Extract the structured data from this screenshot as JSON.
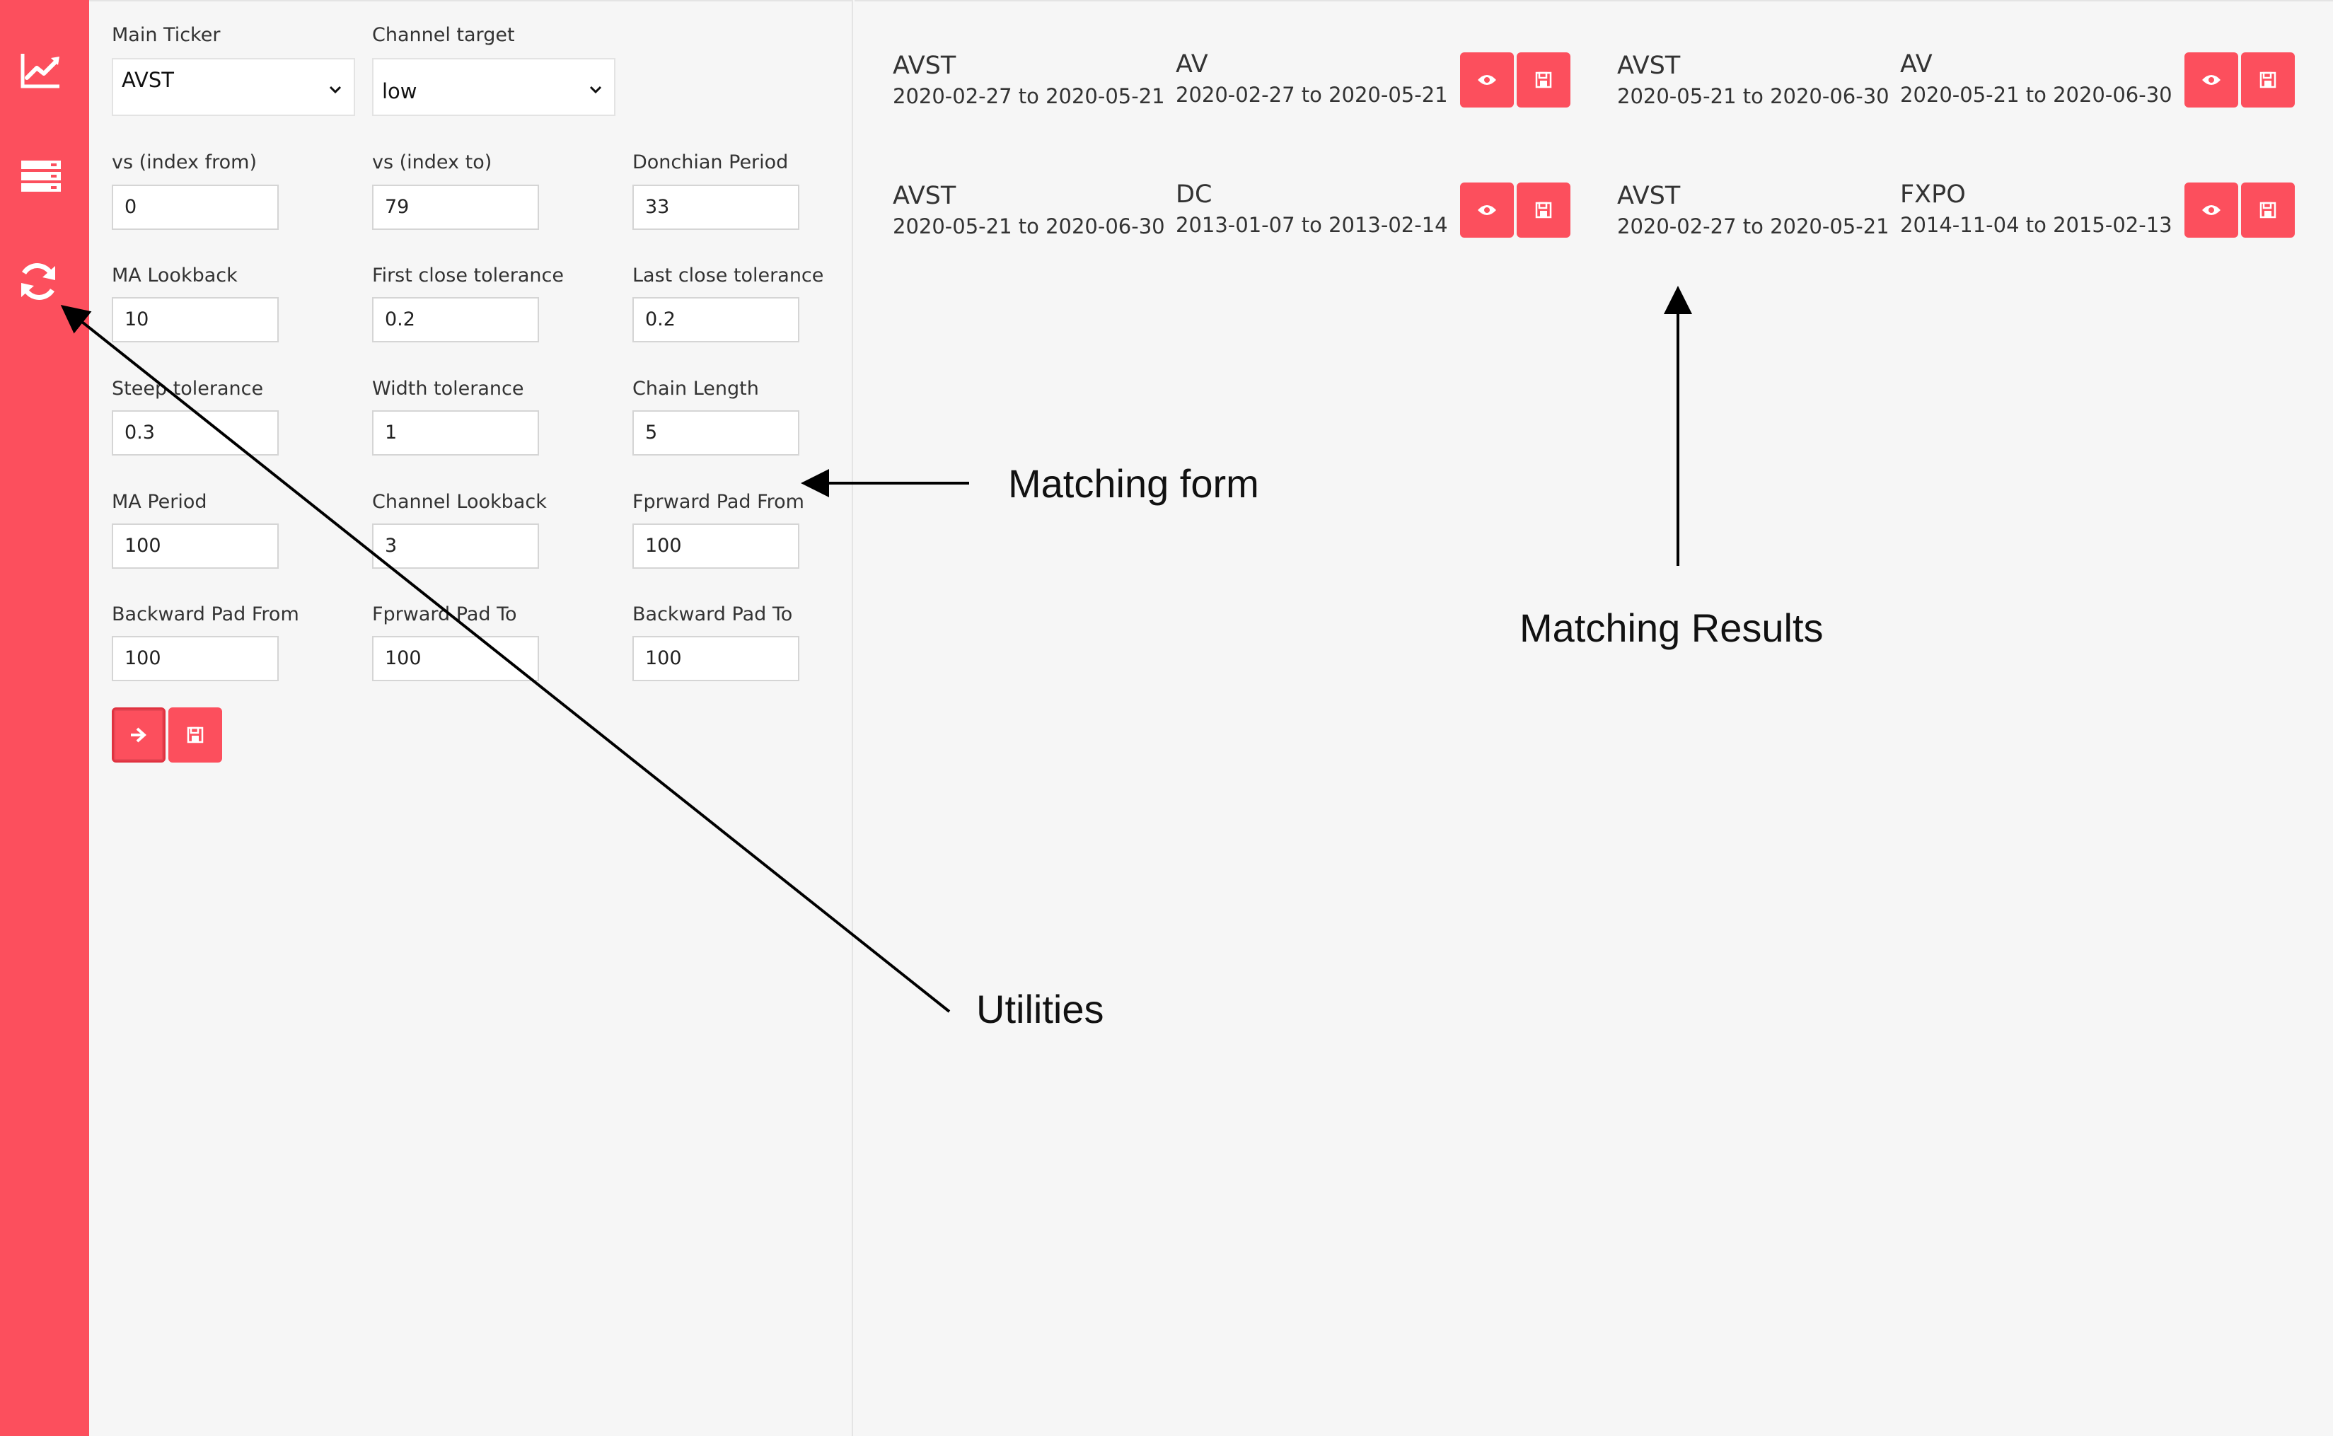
{
  "sidebar": {
    "items": [
      {
        "icon": "line-chart-icon"
      },
      {
        "icon": "server-stack-icon"
      },
      {
        "icon": "refresh-icon"
      }
    ]
  },
  "form": {
    "main_ticker": {
      "label": "Main Ticker",
      "value": "AVST"
    },
    "channel_target": {
      "label": "Channel target",
      "value": "low"
    },
    "fields": [
      {
        "label": "vs (index from)",
        "value": "0"
      },
      {
        "label": "vs (index to)",
        "value": "79"
      },
      {
        "label": "Donchian Period",
        "value": "33"
      },
      {
        "label": "MA Lookback",
        "value": "10"
      },
      {
        "label": "First close tolerance",
        "value": "0.2"
      },
      {
        "label": "Last close tolerance",
        "value": "0.2"
      },
      {
        "label": "Steep tolerance",
        "value": "0.3"
      },
      {
        "label": "Width tolerance",
        "value": "1"
      },
      {
        "label": "Chain Length",
        "value": "5"
      },
      {
        "label": "MA Period",
        "value": "100"
      },
      {
        "label": "Channel Lookback",
        "value": "3"
      },
      {
        "label": "Fprward Pad From",
        "value": "100"
      },
      {
        "label": "Backward Pad From",
        "value": "100"
      },
      {
        "label": "Fprward Pad To",
        "value": "100"
      },
      {
        "label": "Backward Pad To",
        "value": "100"
      }
    ],
    "buttons": [
      {
        "icon": "arrow-right-icon"
      },
      {
        "icon": "save-icon"
      }
    ]
  },
  "results": [
    {
      "a_ticker": "AVST",
      "a_range": "2020-02-27 to 2020-05-21",
      "b_ticker": "AV",
      "b_range": "2020-02-27 to 2020-05-21"
    },
    {
      "a_ticker": "AVST",
      "a_range": "2020-05-21 to 2020-06-30",
      "b_ticker": "AV",
      "b_range": "2020-05-21 to 2020-06-30"
    },
    {
      "a_ticker": "AVST",
      "a_range": "2020-05-21 to 2020-06-30",
      "b_ticker": "DC",
      "b_range": "2013-01-07 to 2013-02-14"
    },
    {
      "a_ticker": "AVST",
      "a_range": "2020-02-27 to 2020-05-21",
      "b_ticker": "FXPO",
      "b_range": "2014-11-04 to 2015-02-13"
    }
  ],
  "annotations": {
    "matching_form": "Matching form",
    "matching_results": "Matching Results",
    "utilities": "Utilities"
  },
  "colors": {
    "accent": "#fc4f5d",
    "background": "#f6f6f6"
  }
}
